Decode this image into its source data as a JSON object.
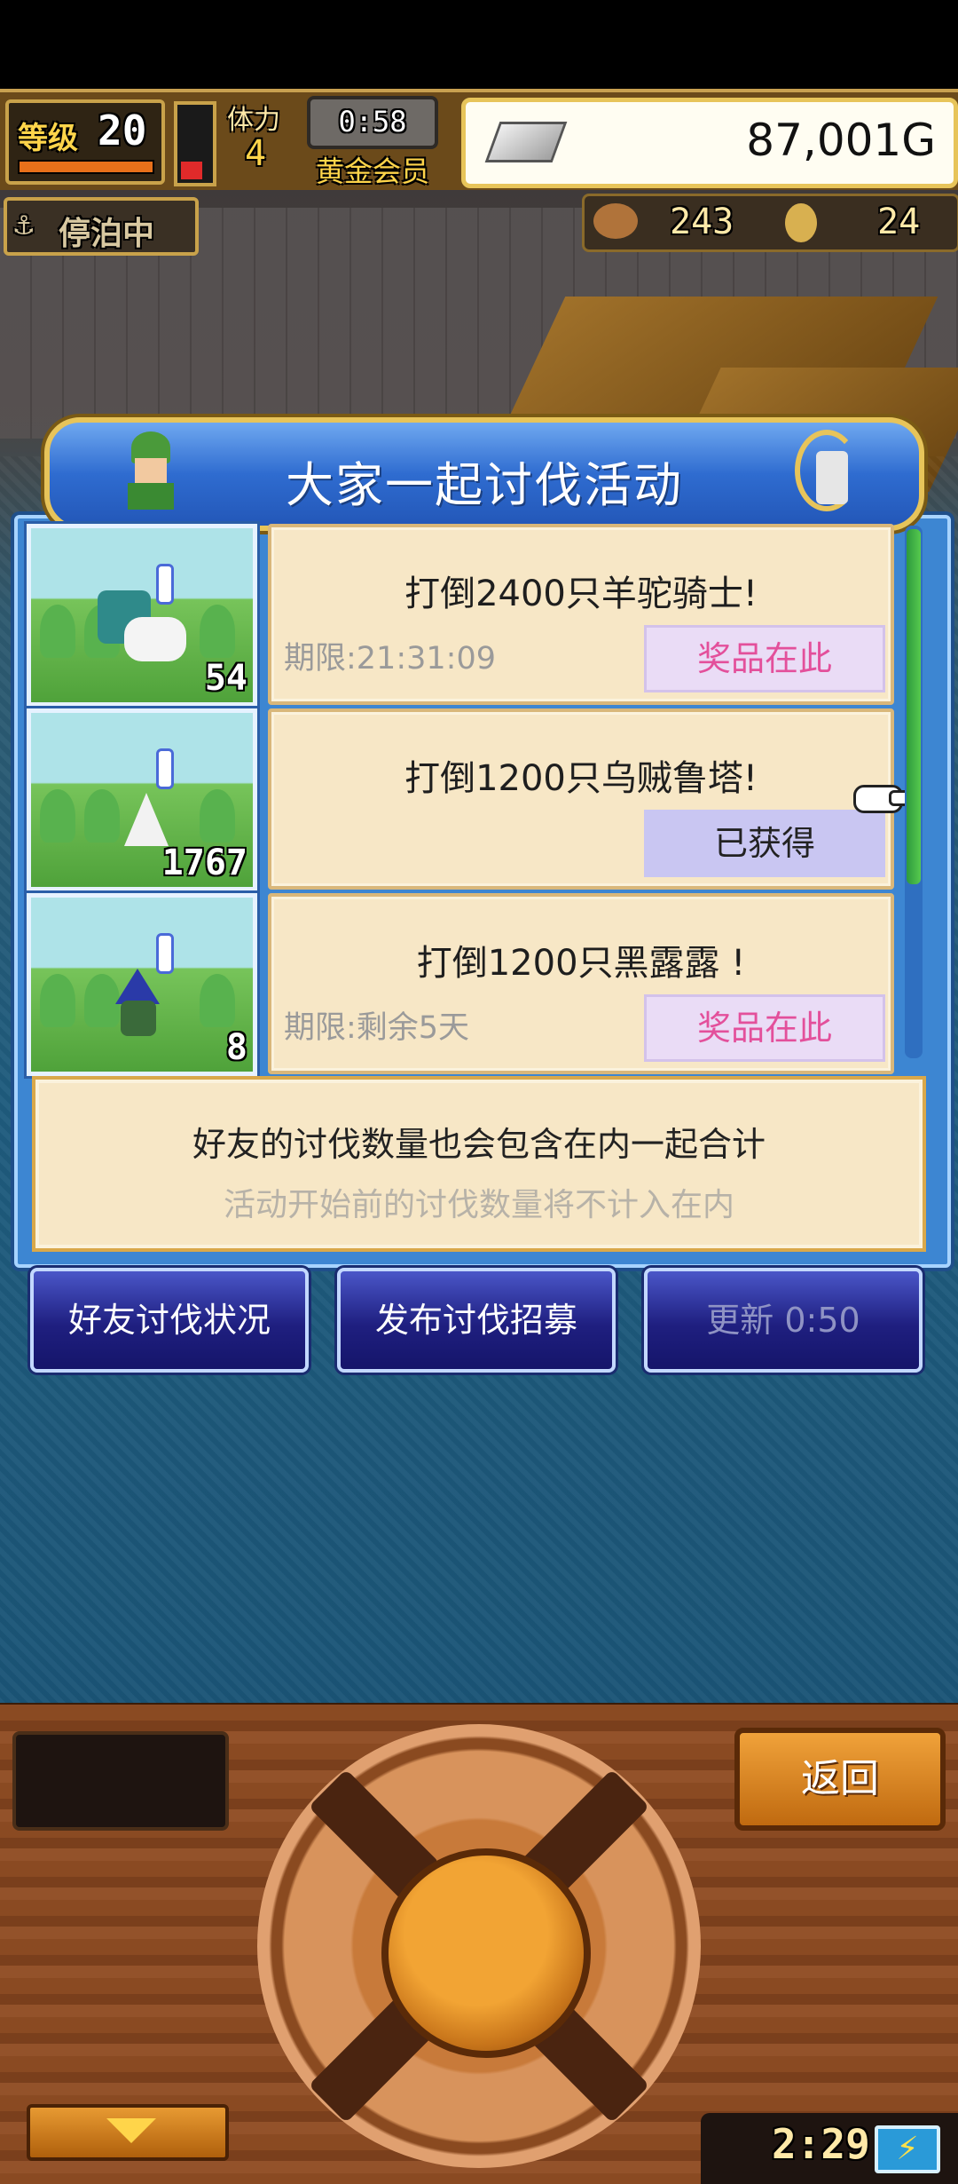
{
  "hud": {
    "level_label": "等级",
    "level_value": "20",
    "stamina_label": "体力",
    "stamina_value": "4",
    "timer": "0:58",
    "membership": "黄金会员",
    "gold": "87,001G",
    "dock_status": "停泊中",
    "resource1": "243",
    "resource2": "24"
  },
  "event": {
    "title": "大家一起讨伐活动",
    "quests": [
      {
        "target": "打倒2400只羊驼骑士!",
        "limit": "期限:21:31:09",
        "prize": "奖品在此",
        "count": "54",
        "prize_state": "available"
      },
      {
        "target": "打倒1200只乌贼鲁塔!",
        "limit": "",
        "prize": "已获得",
        "count": "1767",
        "prize_state": "obtained"
      },
      {
        "target": "打倒1200只黑露露 !",
        "limit": "期限:剩余5天",
        "prize": "奖品在此",
        "count": "8",
        "prize_state": "available"
      }
    ],
    "info_main": "好友的讨伐数量也会包含在内一起合计",
    "info_sub": "活动开始前的讨伐数量将不计入在内"
  },
  "buttons": {
    "friends": "好友讨伐状况",
    "recruit": "发布讨伐招募",
    "refresh": "更新 0:50"
  },
  "console": {
    "back": "返回",
    "clock": "2:29",
    "battery_icon": "⚡"
  },
  "colors": {
    "panel_blue": "#3d86d2",
    "card_cream": "#f7e7c6",
    "prize_pink": "#e3509b",
    "gold": "#e7c45a"
  }
}
